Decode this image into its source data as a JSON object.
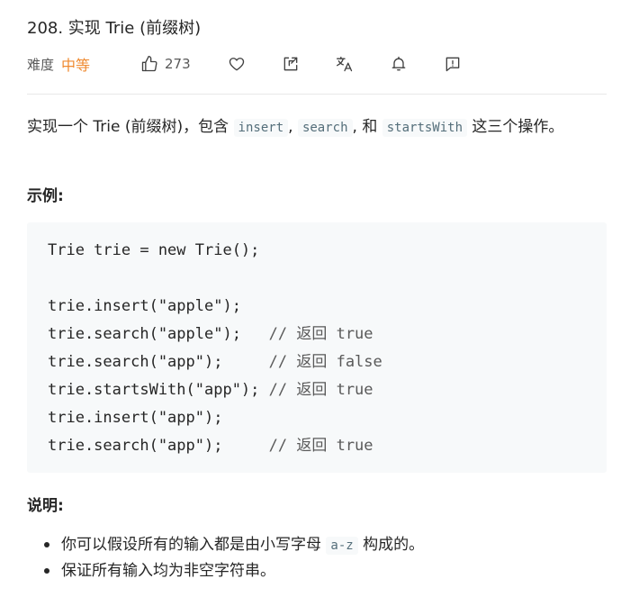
{
  "problem": {
    "title": "208. 实现 Trie (前缀树)",
    "difficulty_label": "难度",
    "difficulty": "中等",
    "like_count": "273"
  },
  "toolbar": {
    "icons": [
      "thumbs-up-icon",
      "heart-icon",
      "share-icon",
      "translate-icon",
      "bell-icon",
      "feedback-icon"
    ]
  },
  "description": {
    "prefix": "实现一个 Trie (前缀树)，包含 ",
    "code1": "insert",
    "sep1": ", ",
    "code2": "search",
    "sep2": ", 和 ",
    "code3": "startsWith",
    "suffix": " 这三个操作。"
  },
  "example": {
    "heading": "示例:",
    "lines": [
      {
        "code": "Trie trie = new Trie();",
        "comment": ""
      },
      {
        "code": "",
        "comment": ""
      },
      {
        "code": "trie.insert(\"apple\");",
        "comment": ""
      },
      {
        "code": "trie.search(\"apple\");   ",
        "comment": "// 返回 true"
      },
      {
        "code": "trie.search(\"app\");     ",
        "comment": "// 返回 false"
      },
      {
        "code": "trie.startsWith(\"app\"); ",
        "comment": "// 返回 true"
      },
      {
        "code": "trie.insert(\"app\");",
        "comment": ""
      },
      {
        "code": "trie.search(\"app\");     ",
        "comment": "// 返回 true"
      }
    ]
  },
  "notes": {
    "heading": "说明:",
    "item1_prefix": "你可以假设所有的输入都是由小写字母 ",
    "item1_code": "a-z",
    "item1_suffix": " 构成的。",
    "item2": "保证所有输入均为非空字符串。"
  },
  "colors": {
    "difficulty": "#ef8a30",
    "code_bg": "#f7f9fa",
    "inline_code": "#546e7a"
  }
}
